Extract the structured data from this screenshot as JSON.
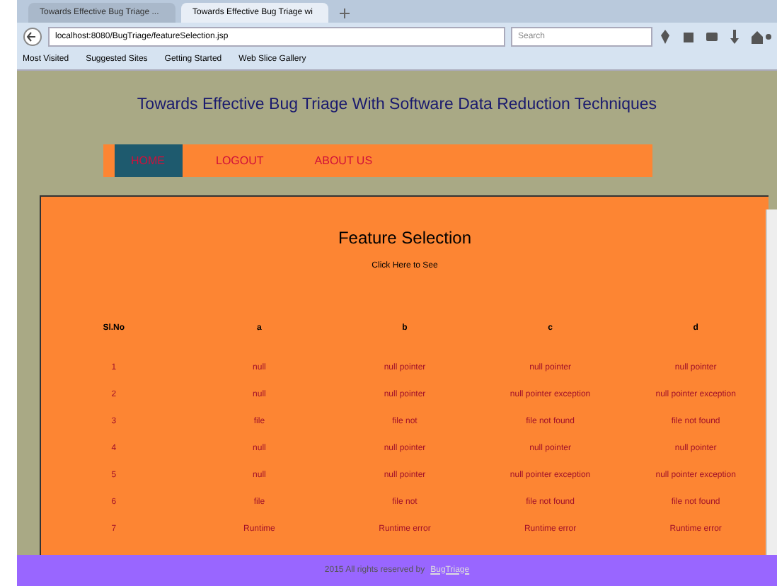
{
  "browser": {
    "tabs": [
      {
        "label": "Towards Effective Bug Triage ...",
        "selected": false
      },
      {
        "label": "Towards Effective Bug Triage wi",
        "selected": true
      }
    ],
    "address": "localhost:8080/BugTriage/featureSelection.jsp",
    "search": {
      "placeholder": "Search"
    },
    "bookmarks": [
      "Most Visited",
      "Suggested Sites",
      "Getting Started",
      "Web Slice Gallery"
    ]
  },
  "site_title": "Towards Effective Bug Triage With Software Data Reduction Techniques",
  "nav": [
    {
      "label": "HOME",
      "selected": true
    },
    {
      "label": "LOGOUT",
      "selected": false
    },
    {
      "label": "ABOUT US",
      "selected": false
    }
  ],
  "panel": {
    "heading": "Feature Selection",
    "link": "Click Here to See"
  },
  "table": {
    "columns": [
      "Sl.No",
      "a",
      "b",
      "c",
      "d"
    ],
    "rows": [
      [
        "1",
        "null",
        "null pointer",
        "null pointer",
        "null pointer"
      ],
      [
        "2",
        "null",
        "null pointer",
        "null pointer exception",
        "null pointer exception"
      ],
      [
        "3",
        "file",
        "file not",
        "file not found",
        "file not found"
      ],
      [
        "4",
        "null",
        "null pointer",
        "null pointer",
        "null pointer"
      ],
      [
        "5",
        "null",
        "null pointer",
        "null pointer exception",
        "null pointer exception"
      ],
      [
        "6",
        "file",
        "file not",
        "file not found",
        "file not found"
      ],
      [
        "7",
        "Runtime",
        "Runtime error",
        "Runtime error",
        "Runtime error"
      ]
    ]
  },
  "footer": {
    "text": "2015 All rights reserved by",
    "link": "BugTriage"
  }
}
